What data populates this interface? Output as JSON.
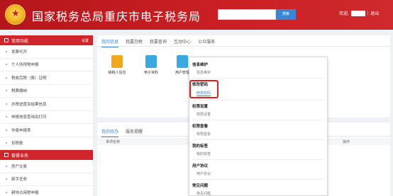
{
  "header": {
    "title": "国家税务总局重庆市电子税务局",
    "search_placeholder": "",
    "search_label": "搜索",
    "welcome": "欢迎,",
    "separator": "|",
    "logout": "退出",
    "bg_color": "#c91f24"
  },
  "sidebar": {
    "section1": {
      "label": "常用功能",
      "right": "设置"
    },
    "items1": [
      "发票代开",
      "个人所得税申报",
      "税收完税（费）证明",
      "税票缴纳",
      "办税进度及结果信息",
      "申报信息查询及打印",
      "作废申报表",
      "扣税款"
    ],
    "section2": {
      "label": "套餐业务"
    },
    "items2": [
      "房产交易",
      "新手任务",
      "耕地占用税申报"
    ]
  },
  "main": {
    "tabs": [
      "我的信息",
      "我要办税",
      "我要查询",
      "互动中心",
      "公众服务"
    ],
    "tiles": [
      {
        "label": "纳税人信息",
        "icon": "taxpayer-info-icon",
        "color": "#f0a81e"
      },
      {
        "label": "电子资料",
        "icon": "e-documents-icon",
        "color": "#39a9e0"
      },
      {
        "label": "用户管理",
        "icon": "user-management-icon",
        "color": "#39a9e0"
      }
    ],
    "bottom_tabs": [
      "我的待办",
      "服务提醒"
    ],
    "table_headers": [
      "事项名称",
      "操作"
    ]
  },
  "dropdown": {
    "groups": [
      {
        "title": "信息维护",
        "items": [
          "信息维护"
        ]
      },
      {
        "title": "修改密码",
        "items": [
          "修改密码"
        ],
        "highlighted": true
      },
      {
        "title": "权限设置",
        "items": [
          "权限设置"
        ]
      },
      {
        "title": "权限查看",
        "items": [
          "权限查看"
        ]
      },
      {
        "title": "我的标签",
        "items": [
          "我的标签"
        ]
      },
      {
        "title": "用户协议",
        "items": [
          "用户协议"
        ]
      },
      {
        "title": "常见问题",
        "items": [
          "常见问题"
        ]
      }
    ],
    "highlight_color": "#e01e1e"
  }
}
